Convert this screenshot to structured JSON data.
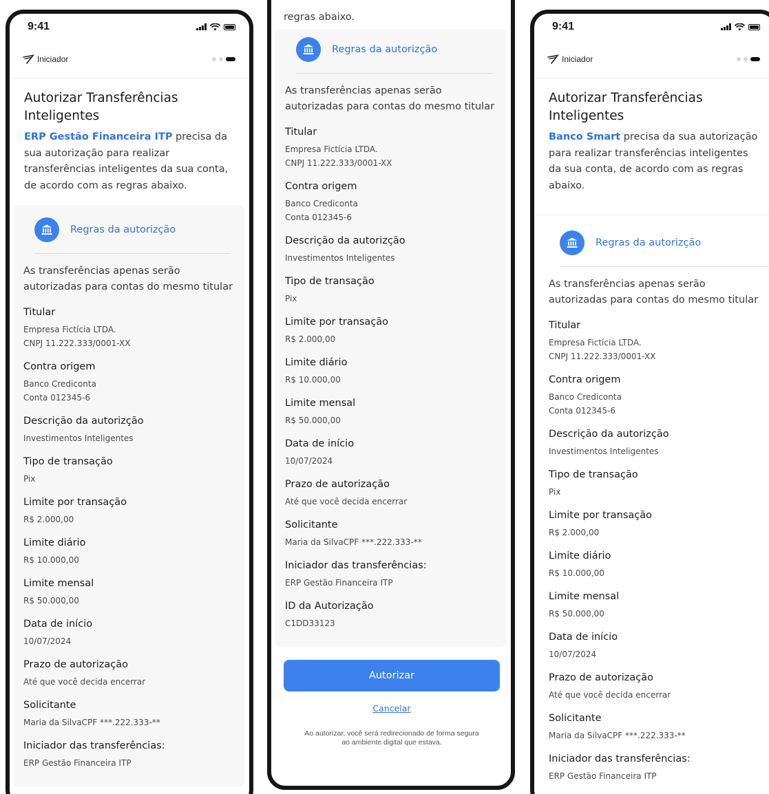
{
  "status": {
    "time": "9:41"
  },
  "app": {
    "brand": "Iniciador"
  },
  "screen1": {
    "title": "Autorizar Transferências Inteligentes",
    "requester_link": "ERP Gestão Financeira ITP",
    "description": " precisa da sua autorização para realizar transferências inteligentes da sua conta, de acordo com as regras abaixo."
  },
  "screen2": {
    "top_text": "regras abaixo."
  },
  "screen3": {
    "title": "Autorizar Transferências Inteligentes",
    "requester_link": "Banco Smart",
    "description": " precisa da sua autorização para realizar transferências inteligentes da sua conta, de acordo com as regras abaixo."
  },
  "rules": {
    "title": "Regras da autorizção",
    "intro": "As transferências apenas serão autorizadas para contas do mesmo titular"
  },
  "fields": [
    {
      "label": "Titular",
      "value": "Empresa Fictícia LTDA.\nCNPJ 11.222.333/0001-XX"
    },
    {
      "label": "Contra origem",
      "value": "Banco Crediconta\nConta 012345-6"
    },
    {
      "label": "Descrição da autorizção",
      "value": "Investimentos Inteligentes"
    },
    {
      "label": "Tipo de transação",
      "value": "Pix"
    },
    {
      "label": "Limite por transação",
      "value": "R$ 2.000,00"
    },
    {
      "label": "Limite diário",
      "value": "R$ 10.000,00"
    },
    {
      "label": "Limite mensal",
      "value": "R$ 50.000,00"
    },
    {
      "label": "Data de início",
      "value": "10/07/2024"
    },
    {
      "label": "Prazo de autorização",
      "value": "Até que você decida encerrar"
    },
    {
      "label": "Solicitante",
      "value": "Maria da SilvaCPF ***.222.333-**"
    },
    {
      "label": "Iniciador das transferências:",
      "value": "ERP Gestão Financeira ITP"
    },
    {
      "label": "ID da Autorização",
      "value": "C1DD33123"
    }
  ],
  "actions": {
    "authorize": "Autorizar",
    "cancel": "Cancelar",
    "footnote": "Ao autorizar, você será redirecionado de forma segura ao ambiente digital que estava."
  },
  "colors": {
    "accent": "#3d82ec",
    "link": "#2e76d9",
    "card": "#f7f7f8"
  },
  "icons": [
    "signal-icon",
    "wifi-icon",
    "battery-icon",
    "iniciador-logo-icon",
    "bank-icon",
    "step-dots"
  ]
}
